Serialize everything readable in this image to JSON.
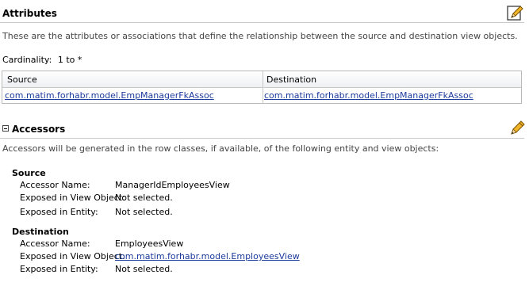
{
  "attributes": {
    "title": "Attributes",
    "description": "These are the attributes or associations that define the relationship between the source and destination view objects.",
    "cardinality_label": "Cardinality:",
    "cardinality_value": "1 to *",
    "table": {
      "columns": [
        "Source",
        "Destination"
      ],
      "rows": [
        [
          "com.matim.forhabr.model.EmpManagerFkAssoc",
          "com.matim.forhabr.model.EmpManagerFkAssoc"
        ]
      ]
    },
    "edit_icon": "edit-pencil-icon"
  },
  "accessors": {
    "title": "Accessors",
    "toggle_icon": "collapse-minus-icon",
    "edit_icon": "pencil-icon",
    "description": "Accessors will be generated in the row classes, if available, of the following entity and view objects:",
    "source": {
      "heading": "Source",
      "accessor_name_label": "Accessor Name:",
      "accessor_name": "ManagerIdEmployeesView",
      "exposed_vo_label": "Exposed in View Object:",
      "exposed_vo": "Not selected.",
      "exposed_entity_label": "Exposed in Entity:",
      "exposed_entity": "Not selected."
    },
    "destination": {
      "heading": "Destination",
      "accessor_name_label": "Accessor Name:",
      "accessor_name": "EmployeesView",
      "exposed_vo_label": "Exposed in View Object:",
      "exposed_vo": "com.matim.forhabr.model.EmployeesView",
      "exposed_entity_label": "Exposed in Entity:",
      "exposed_entity": "Not selected."
    }
  },
  "colors": {
    "link": "#1c3b9c",
    "divider": "#c9c9c9",
    "pencil": "#e5a21a"
  }
}
